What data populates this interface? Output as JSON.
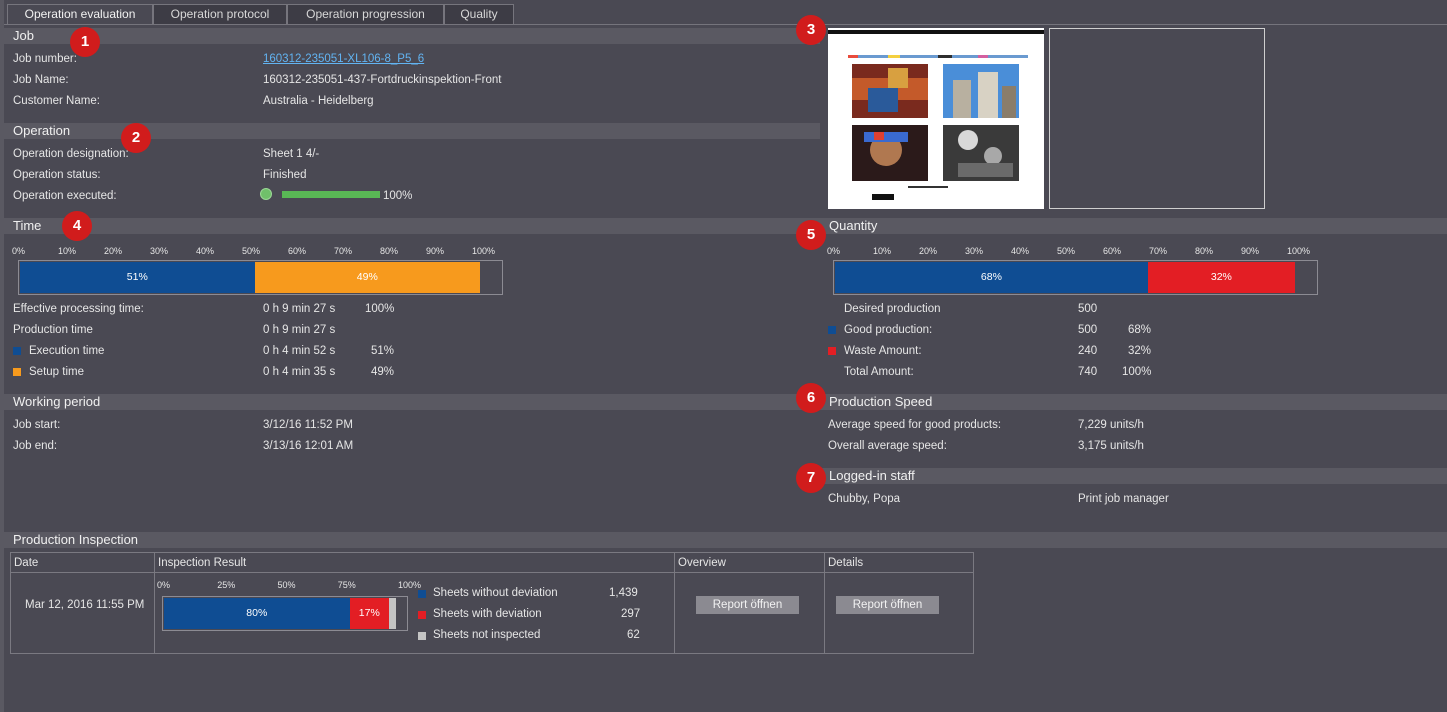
{
  "tabs": [
    "Operation evaluation",
    "Operation protocol",
    "Operation progression",
    "Quality"
  ],
  "callouts": [
    "1",
    "2",
    "3",
    "4",
    "5",
    "6",
    "7"
  ],
  "job": {
    "title": "Job",
    "rows": [
      {
        "label": "Job number:",
        "value": "160312-235051-XL106-8_P5_6"
      },
      {
        "label": "Job Name:",
        "value": "160312-235051-437-Fortdruckinspektion-Front"
      },
      {
        "label": "Customer Name:",
        "value": "Australia - Heidelberg"
      }
    ]
  },
  "operation": {
    "title": "Operation",
    "rows": [
      {
        "label": "Operation designation:",
        "value": "Sheet 1  4/-"
      },
      {
        "label": "Operation status:",
        "value": "Finished"
      },
      {
        "label": "Operation executed:",
        "value": "100%"
      }
    ],
    "executed_fraction": 1.0
  },
  "time": {
    "title": "Time",
    "ticks": [
      "0%",
      "10%",
      "20%",
      "30%",
      "40%",
      "50%",
      "60%",
      "70%",
      "80%",
      "90%",
      "100%"
    ],
    "segments": [
      {
        "label": "51%",
        "value": 51,
        "color": "#0f4d93"
      },
      {
        "label": "49%",
        "value": 49,
        "color": "#f79a1d"
      }
    ],
    "rows": [
      {
        "label": "Effective processing time:",
        "value": "0 h  9 min 27 s",
        "pct": "100%"
      },
      {
        "label": "Production time",
        "value": "0 h  9 min 27 s",
        "pct": ""
      },
      {
        "label": "Execution time",
        "value": "0 h  4 min 52 s",
        "pct": "51%",
        "color": "#0f4d93"
      },
      {
        "label": "Setup time",
        "value": "0 h  4 min 35 s",
        "pct": "49%",
        "color": "#f79a1d"
      }
    ]
  },
  "working": {
    "title": "Working period",
    "rows": [
      {
        "label": "Job start:",
        "value": "3/12/16 11:52 PM"
      },
      {
        "label": "Job end:",
        "value": "3/13/16 12:01 AM"
      }
    ]
  },
  "quantity": {
    "title": "Quantity",
    "ticks": [
      "0%",
      "10%",
      "20%",
      "30%",
      "40%",
      "50%",
      "60%",
      "70%",
      "80%",
      "90%",
      "100%"
    ],
    "segments": [
      {
        "label": "68%",
        "value": 68,
        "color": "#0f4d93"
      },
      {
        "label": "32%",
        "value": 32,
        "color": "#e31e24"
      }
    ],
    "rows": [
      {
        "label": "Desired production",
        "value": "500",
        "pct": ""
      },
      {
        "label": "Good production:",
        "value": "500",
        "pct": "68%",
        "color": "#0f4d93"
      },
      {
        "label": "Waste Amount:",
        "value": "240",
        "pct": "32%",
        "color": "#e31e24"
      },
      {
        "label": "Total Amount:",
        "value": "740",
        "pct": "100%"
      }
    ]
  },
  "speed": {
    "title": "Production Speed",
    "rows": [
      {
        "label": "Average speed for good products:",
        "value": "7,229 units/h"
      },
      {
        "label": "Overall average speed:",
        "value": "3,175 units/h"
      }
    ]
  },
  "staff": {
    "title": "Logged-in staff",
    "name": "Chubby, Popa",
    "role": "Print job manager"
  },
  "inspection": {
    "title": "Production Inspection",
    "columns": [
      "Date",
      "Inspection Result",
      "Overview",
      "Details"
    ],
    "date": "Mar 12, 2016 11:55 PM",
    "ticks": [
      "0%",
      "25%",
      "50%",
      "75%",
      "100%"
    ],
    "segments": [
      {
        "label": "80%",
        "value": 80,
        "color": "#0f4d93"
      },
      {
        "label": "17%",
        "value": 17,
        "color": "#e31e24"
      },
      {
        "label": "",
        "value": 3,
        "color": "#c4c4c4"
      }
    ],
    "legend": [
      {
        "label": "Sheets without deviation",
        "value": "1,439",
        "color": "#0f4d93"
      },
      {
        "label": "Sheets with deviation",
        "value": "297",
        "color": "#e31e24"
      },
      {
        "label": "Sheets not inspected",
        "value": "62",
        "color": "#c4c4c4"
      }
    ],
    "overview_button": "Report öffnen",
    "details_button": "Report öffnen"
  }
}
